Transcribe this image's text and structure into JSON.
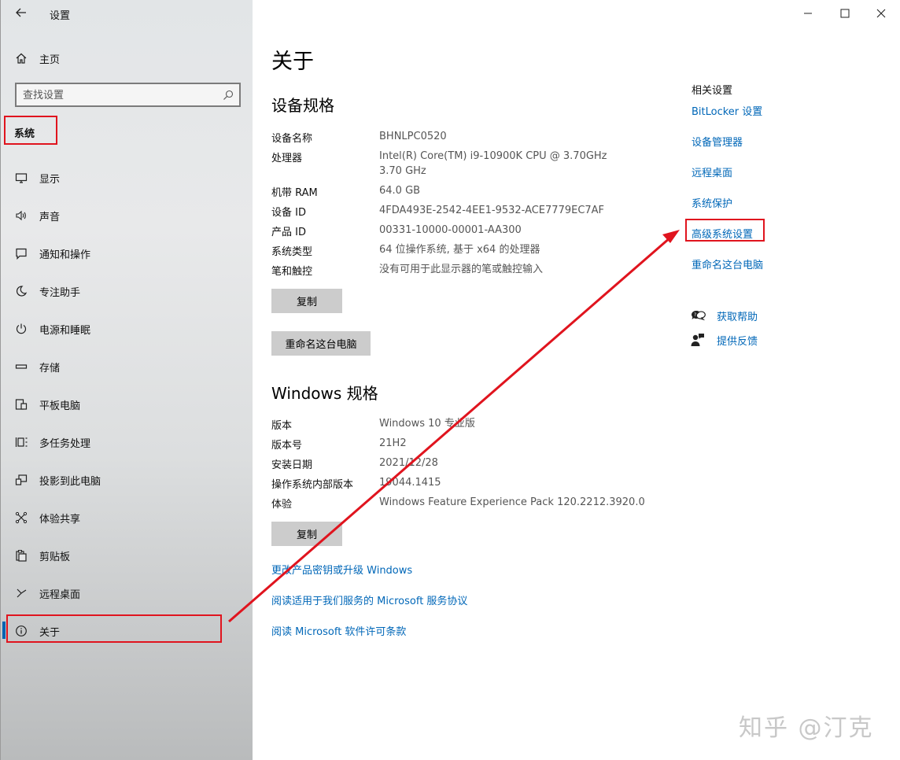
{
  "window": {
    "title": "设置",
    "controls": {
      "minimize_icon": "minimize-icon",
      "maximize_icon": "maximize-icon",
      "close_icon": "close-icon"
    }
  },
  "sidebar": {
    "home_label": "主页",
    "search_placeholder": "查找设置",
    "section_label": "系统",
    "items": [
      {
        "label": "显示",
        "icon": "monitor-icon"
      },
      {
        "label": "声音",
        "icon": "speaker-icon"
      },
      {
        "label": "通知和操作",
        "icon": "notification-icon"
      },
      {
        "label": "专注助手",
        "icon": "moon-icon"
      },
      {
        "label": "电源和睡眠",
        "icon": "power-icon"
      },
      {
        "label": "存储",
        "icon": "storage-icon"
      },
      {
        "label": "平板电脑",
        "icon": "tablet-icon"
      },
      {
        "label": "多任务处理",
        "icon": "multitask-icon"
      },
      {
        "label": "投影到此电脑",
        "icon": "project-icon"
      },
      {
        "label": "体验共享",
        "icon": "share-icon"
      },
      {
        "label": "剪贴板",
        "icon": "clipboard-icon"
      },
      {
        "label": "远程桌面",
        "icon": "remote-desktop-icon"
      },
      {
        "label": "关于",
        "icon": "info-icon"
      }
    ]
  },
  "main": {
    "page_title": "关于",
    "device_spec": {
      "heading": "设备规格",
      "rows": [
        {
          "key": "设备名称",
          "value": "BHNLPC0520"
        },
        {
          "key": "处理器",
          "value": "Intel(R) Core(TM) i9-10900K CPU @ 3.70GHz   3.70 GHz"
        },
        {
          "key": "机带 RAM",
          "value": "64.0 GB"
        },
        {
          "key": "设备 ID",
          "value": "4FDA493E-2542-4EE1-9532-ACE7779EC7AF"
        },
        {
          "key": "产品 ID",
          "value": "00331-10000-00001-AA300"
        },
        {
          "key": "系统类型",
          "value": "64 位操作系统, 基于 x64 的处理器"
        },
        {
          "key": "笔和触控",
          "value": "没有可用于此显示器的笔或触控输入"
        }
      ],
      "copy_label": "复制",
      "rename_label": "重命名这台电脑"
    },
    "windows_spec": {
      "heading": "Windows 规格",
      "rows": [
        {
          "key": "版本",
          "value": "Windows 10 专业版"
        },
        {
          "key": "版本号",
          "value": "21H2"
        },
        {
          "key": "安装日期",
          "value": "2021/12/28"
        },
        {
          "key": "操作系统内部版本",
          "value": "19044.1415"
        },
        {
          "key": "体验",
          "value": "Windows Feature Experience Pack 120.2212.3920.0"
        }
      ],
      "copy_label": "复制"
    },
    "links": [
      "更改产品密钥或升级 Windows",
      "阅读适用于我们服务的 Microsoft 服务协议",
      "阅读 Microsoft 软件许可条款"
    ]
  },
  "related": {
    "heading": "相关设置",
    "links": [
      "BitLocker 设置",
      "设备管理器",
      "远程桌面",
      "系统保护",
      "高级系统设置",
      "重命名这台电脑"
    ],
    "help_label": "获取帮助",
    "feedback_label": "提供反馈"
  },
  "annotations": {
    "highlight_color": "#e0141e"
  },
  "watermark": "知乎 @汀克"
}
